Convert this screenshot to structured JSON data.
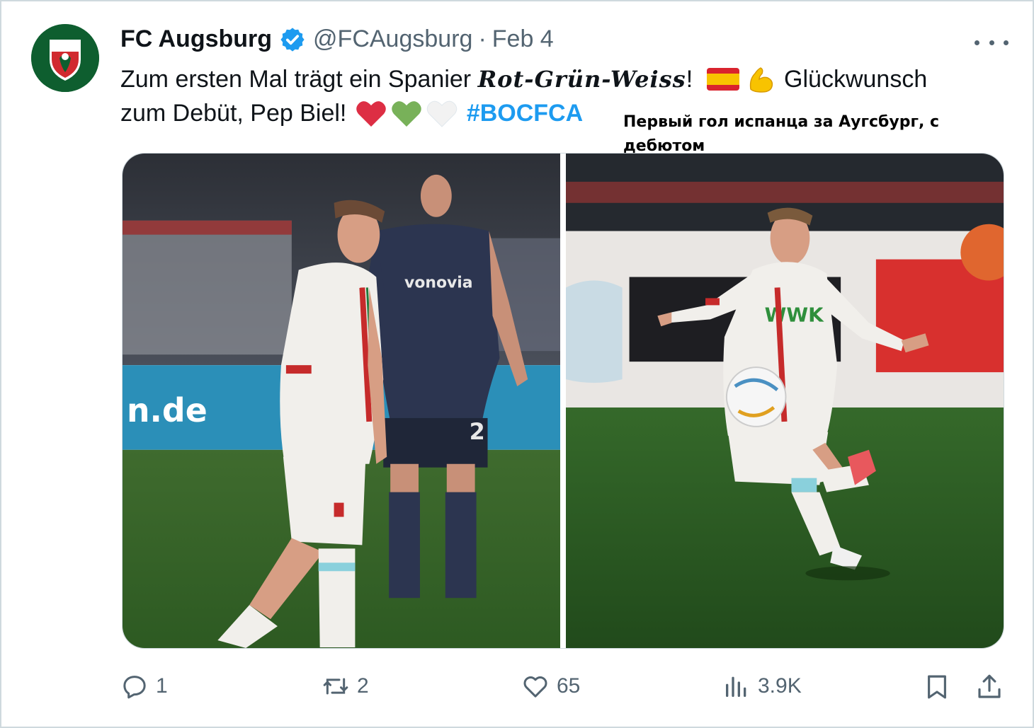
{
  "tweet": {
    "author_name": "FC Augsburg",
    "handle": "@FCAugsburg",
    "separator": "·",
    "date": "Feb 4",
    "text_part1": "Zum ersten Mal trägt ein Spanier ",
    "text_script": "Rot-Grün-Weiss",
    "text_part2": "! ",
    "text_part3": " Glückwunsch",
    "text_line2": "zum Debüt, Pep Biel! ",
    "hashtag": "#BOCFCA"
  },
  "overlay_note": "Первый гол испанца за Аугсбург, с дебютом",
  "media": {
    "photo_left_sponsor": "vonovia",
    "photo_left_number": "2",
    "photo_left_board": "n.de",
    "photo_right_shirt": "WWK"
  },
  "actions": {
    "replies": "1",
    "reposts": "2",
    "likes": "65",
    "views": "3.9K"
  },
  "colors": {
    "accent": "#1d9bf0",
    "muted": "#536471",
    "club_green": "#0e5e2f",
    "club_red": "#d12a2f"
  },
  "icons": [
    "verified-badge-icon",
    "more-icon",
    "reply-icon",
    "repost-icon",
    "like-icon",
    "views-icon",
    "bookmark-icon",
    "share-icon"
  ]
}
